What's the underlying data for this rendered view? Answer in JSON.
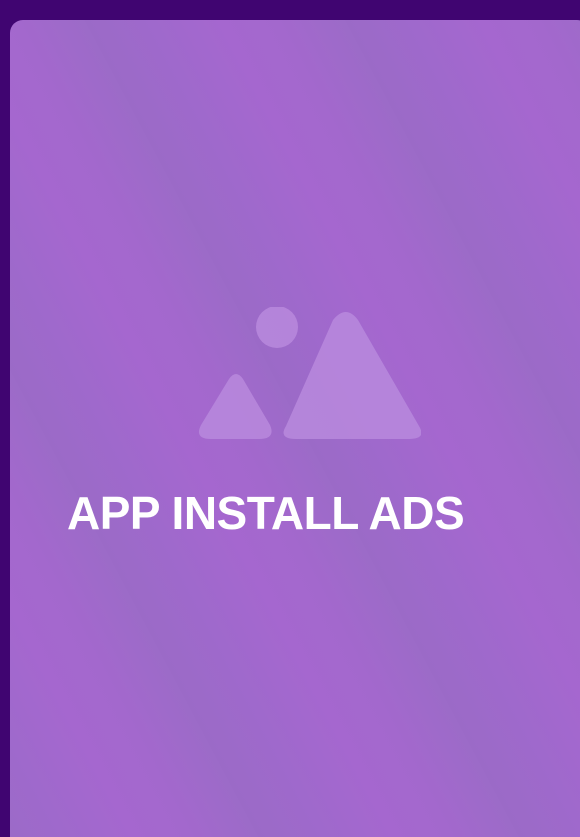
{
  "card": {
    "title": "APP INSTALL ADS",
    "icon": "image-placeholder-icon",
    "title_color": "#ffffff"
  },
  "colors": {
    "page_background": "#400571",
    "card_background": "#a067cb",
    "icon_fill": "#b788dc"
  }
}
